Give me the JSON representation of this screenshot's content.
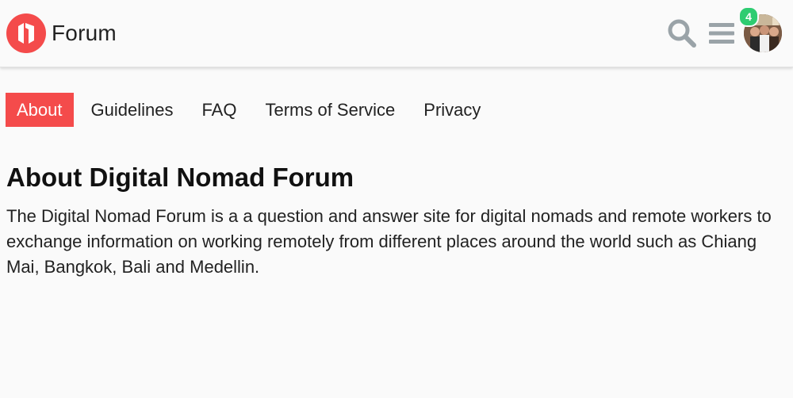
{
  "header": {
    "brand_name": "Forum",
    "logo_icon": "forum-logo-icon",
    "search_icon": "search-icon",
    "menu_icon": "hamburger-menu-icon",
    "notification_count": "4",
    "avatar": "user-avatar"
  },
  "nav": {
    "items": [
      {
        "label": "About",
        "active": true
      },
      {
        "label": "Guidelines",
        "active": false
      },
      {
        "label": "FAQ",
        "active": false
      },
      {
        "label": "Terms of Service",
        "active": false
      },
      {
        "label": "Privacy",
        "active": false
      }
    ]
  },
  "main": {
    "title": "About Digital Nomad Forum",
    "body": "The Digital Nomad Forum is a a question and answer site for digital nomads and remote workers to exchange information on working remotely from different places around the world such as Chiang Mai, Bangkok, Bali and Medellin."
  },
  "colors": {
    "accent": "#f44b4b",
    "badge": "#2ecc71",
    "icon_gray": "#9aa3a8",
    "background": "#fafafa"
  }
}
